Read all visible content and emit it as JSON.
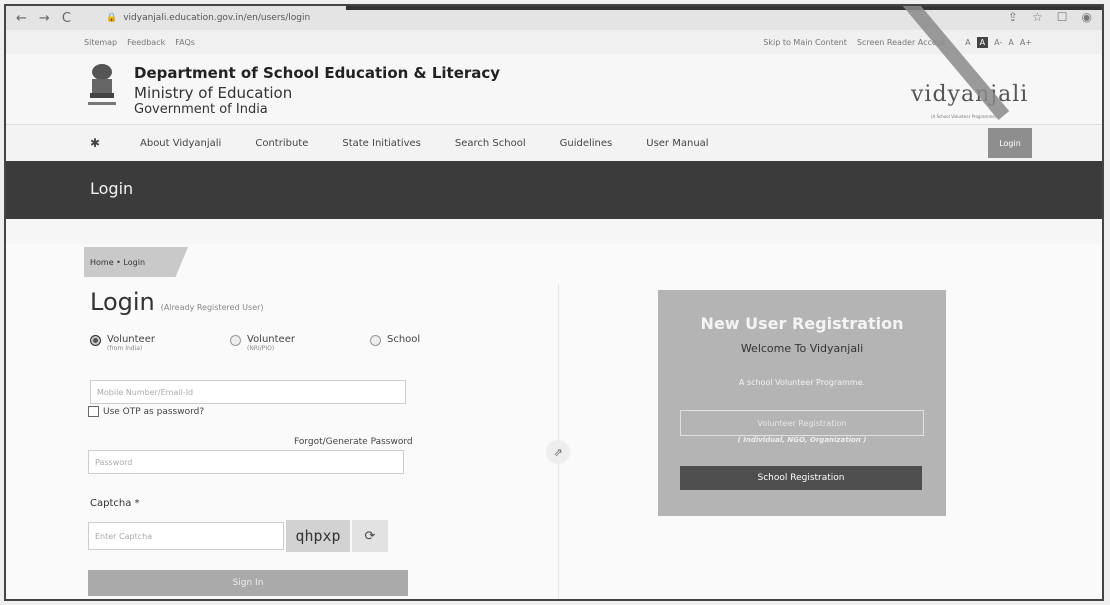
{
  "browser": {
    "back": "←",
    "forward": "→",
    "reload": "C",
    "url": "vidyanjali.education.gov.in/en/users/login",
    "icons": [
      "share-icon",
      "star-icon",
      "sidebar-icon",
      "profile-icon"
    ]
  },
  "utility": {
    "links": [
      "Sitemap",
      "Feedback",
      "FAQs"
    ],
    "skip": "Skip to Main Content",
    "reader": "Screen Reader Access",
    "font_sizes": [
      "A",
      "A",
      "A-",
      "A",
      "A+"
    ]
  },
  "header": {
    "department": "Department of School Education & Literacy",
    "ministry": "Ministry of Education",
    "government": "Government of India",
    "logo_text": "vidyanjali",
    "logo_tagline": "(A School Volunteer Programme)"
  },
  "nav": {
    "home_icon": "home-icon",
    "items": [
      "About Vidyanjali",
      "Contribute",
      "State Initiatives",
      "Search School",
      "Guidelines",
      "User Manual"
    ],
    "login": "Login"
  },
  "banner": {
    "title": "Login"
  },
  "breadcrumb": {
    "text": "Home • Login"
  },
  "login_form": {
    "heading": "Login",
    "subheading": "(Already Registered User)",
    "radios": [
      {
        "label": "Volunteer",
        "sub": "(from India)",
        "checked": true
      },
      {
        "label": "Volunteer",
        "sub": "(NRI/PIO)",
        "checked": false
      },
      {
        "label": "School",
        "sub": "",
        "checked": false
      }
    ],
    "mobile_placeholder": "Mobile Number/Email-Id",
    "otp_label": "Use OTP as password?",
    "forgot": "Forgot/Generate Password",
    "password_placeholder": "Password",
    "captcha_label": "Captcha *",
    "captcha_placeholder": "Enter Captcha",
    "captcha_text": "qhpxp",
    "sign_in": "Sign In"
  },
  "registration": {
    "title": "New User Registration",
    "welcome": "Welcome To Vidyanjali",
    "tagline": "A school Volunteer Programme.",
    "volunteer_btn": "Volunteer Registration",
    "volunteer_sub": "( Individual, NGO, Organization )",
    "school_btn": "School Registration"
  },
  "colors": {
    "banner": "#3b3b3b",
    "panel": "#b4b4b4",
    "school_btn": "#4e4e4e",
    "login_nav": "#8e8e8e"
  }
}
